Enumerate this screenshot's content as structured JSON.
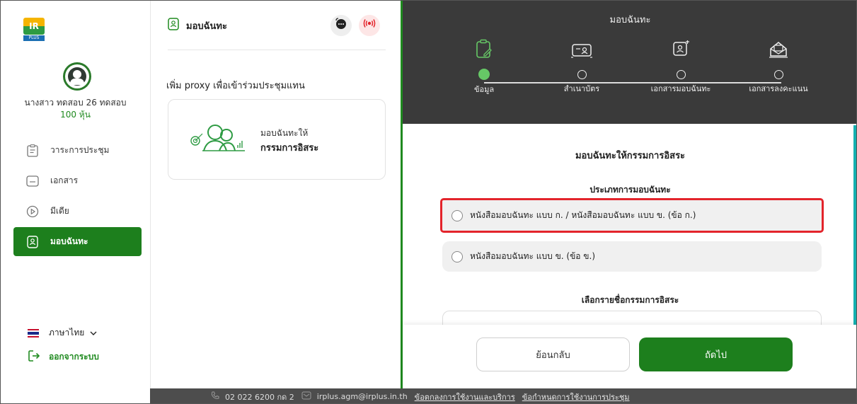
{
  "sidebar": {
    "logo_text": "IR",
    "logo_sub": "PLUS",
    "user_name": "นางสาว ทดสอบ 26 ทดสอบ",
    "user_shares": "100 หุ้น",
    "items": [
      {
        "label": "วาระการประชุม",
        "icon": "agenda-icon"
      },
      {
        "label": "เอกสาร",
        "icon": "folder-icon"
      },
      {
        "label": "มีเดีย",
        "icon": "play-icon"
      },
      {
        "label": "มอบฉันทะ",
        "icon": "proxy-doc-icon",
        "active": true
      }
    ],
    "language": "ภาษาไทย",
    "logout": "ออกจากระบบ"
  },
  "middle": {
    "title": "มอบฉันทะ",
    "subtitle": "เพิ่ม proxy เพื่อเข้าร่วมประชุมแทน",
    "card": {
      "line1": "มอบฉันทะให้",
      "line2": "กรรมการอิสระ"
    }
  },
  "right": {
    "header_title": "มอบฉันทะ",
    "steps": [
      {
        "label": "ข้อมูล",
        "active": true
      },
      {
        "label": "สำเนาบัตร",
        "active": false
      },
      {
        "label": "เอกสารมอบฉันทะ",
        "active": false
      },
      {
        "label": "เอกสารลงคะแนน",
        "active": false
      }
    ],
    "content_title": "มอบฉันทะให้กรรมการอิสระ",
    "proxy_type_label": "ประเภทการมอบฉันทะ",
    "options": [
      "หนังสือมอบฉันทะ แบบ ก. / หนังสือมอบฉันทะ แบบ ข. (ข้อ ก.)",
      "หนังสือมอบฉันทะ แบบ ข. (ข้อ ข.)"
    ],
    "director_label": "เลือกรายชื่อกรรมการอิสระ",
    "back_button": "ย้อนกลับ",
    "next_button": "ถัดไป"
  },
  "footer": {
    "phone": "02 022 6200 กด 2",
    "email": "irplus.agm@irplus.in.th",
    "terms_link": "ข้อตกลงการใช้งานและบริการ",
    "meeting_terms_link": "ข้อกำหนดการใช้งานการประชุม"
  },
  "colors": {
    "brand_green": "#1d7f1d",
    "header_dark": "#3a3a3a",
    "highlight_red": "#e3242b",
    "step_active": "#66c866"
  }
}
